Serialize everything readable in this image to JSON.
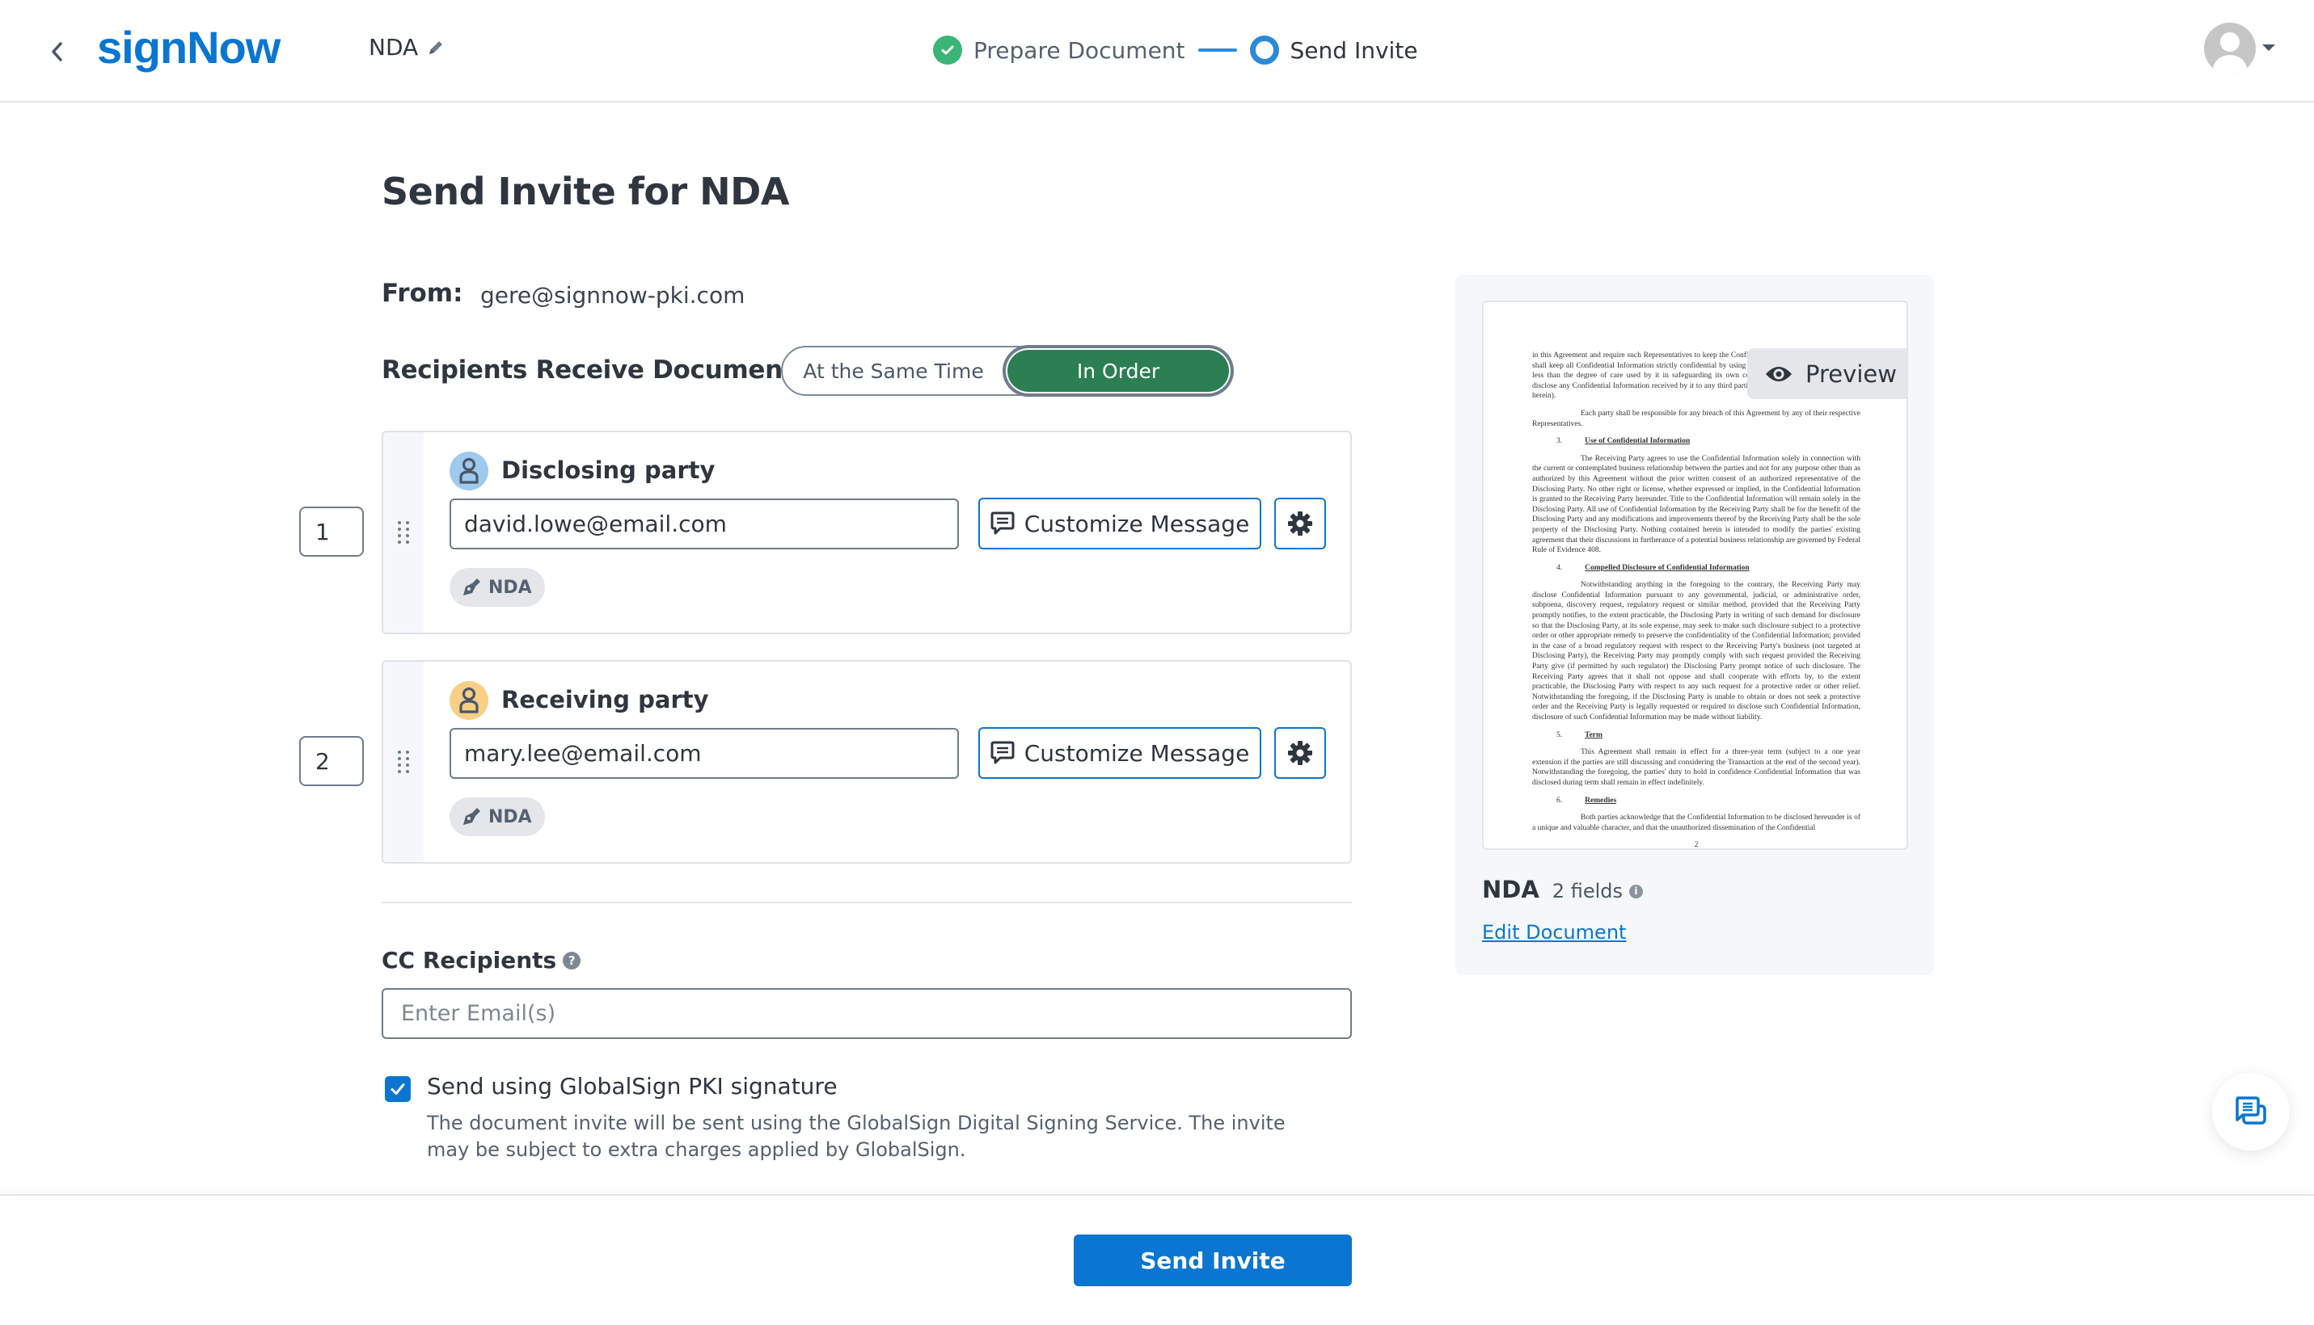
{
  "header": {
    "logo": "signNow",
    "document_name": "NDA",
    "steps": [
      {
        "label": "Prepare Document",
        "state": "done"
      },
      {
        "label": "Send Invite",
        "state": "current"
      }
    ],
    "colors": {
      "brand": "#0a76d1",
      "step_done": "#3bb575",
      "step_current": "#2c8ad8"
    }
  },
  "main": {
    "title": "Send Invite for NDA",
    "from_label": "From:",
    "from_value": "gere@signnow-pki.com",
    "order_label": "Recipients Receive Documents",
    "order_options": [
      {
        "label": "At the Same Time",
        "selected": false
      },
      {
        "label": "In Order",
        "selected": true
      }
    ],
    "recipients": [
      {
        "order": "1",
        "role": "Disclosing party",
        "avatar_color": "#9dcaee",
        "email": "david.lowe@email.com",
        "customize_label": "Customize Message",
        "document_badge": "NDA"
      },
      {
        "order": "2",
        "role": "Receiving party",
        "avatar_color": "#f7cf85",
        "email": "mary.lee@email.com",
        "customize_label": "Customize Message",
        "document_badge": "NDA"
      }
    ],
    "cc": {
      "label": "CC Recipients",
      "help_icon": "?",
      "placeholder": "Enter Email(s)",
      "value": ""
    },
    "pki": {
      "checked": true,
      "label": "Send using GlobalSign PKI signature",
      "description": "The document invite will be sent using the GlobalSign Digital Signing Service. The invite may be subject to extra charges applied by GlobalSign."
    }
  },
  "preview_panel": {
    "preview_label": "Preview",
    "doc_name": "NDA",
    "fields_count": "2 fields",
    "edit_link": "Edit Document",
    "page_text": {
      "p1": "in this Agreement and require such Representatives to keep the Confidential Information confidential, (b) shall keep all Confidential Information strictly confidential by using a reasonable degree of care, but not less than the degree of care used by it in safeguarding its own confidential information, and (c) not disclose any Confidential Information received by it to any third parties (except as otherwise provided for herein).",
      "p2": "Each party shall be responsible for any breach of this Agreement by any of their respective Representatives.",
      "h3_num": "3.",
      "h3": "Use of Confidential Information",
      "p3": "The Receiving Party agrees to use the Confidential Information solely in connection with the current or contemplated business relationship between the parties and not for any purpose other than as authorized by this Agreement without the prior written consent of an authorized representative of the Disclosing Party. No other right or license, whether expressed or implied, in the Confidential Information is granted to the Receiving Party hereunder. Title to the Confidential Information will remain solely in the Disclosing Party. All use of Confidential Information by the Receiving Party shall be for the benefit of the Disclosing Party and any modifications and improvements thereof by the Receiving Party shall be the sole property of the Disclosing Party. Nothing contained herein is intended to modify the parties' existing agreement that their discussions in furtherance of a potential business relationship are governed by Federal Rule of Evidence 408.",
      "h4_num": "4.",
      "h4": "Compelled Disclosure of Confidential Information",
      "p4": "Notwithstanding anything in the foregoing to the contrary, the Receiving Party may disclose Confidential Information pursuant to any governmental, judicial, or administrative order, subpoena, discovery request, regulatory request or similar method, provided that the Receiving Party promptly notifies, to the extent practicable, the Disclosing Party in writing of such demand for disclosure so that the Disclosing Party, at its sole expense, may seek to make such disclosure subject to a protective order or other appropriate remedy to preserve the confidentiality of the Confidential Information; provided in the case of a broad regulatory request with respect to the Receiving Party's business (not targeted at Disclosing Party), the Receiving Party may promptly comply with such request provided the Receiving Party give (if permitted by such regulator) the Disclosing Party prompt notice of such disclosure. The Receiving Party agrees that it shall not oppose and shall cooperate with efforts by, to the extent practicable, the Disclosing Party with respect to any such request for a protective order or other relief. Notwithstanding the foregoing, if the Disclosing Party is unable to obtain or does not seek a protective order and the Receiving Party is legally requested or required to disclose such Confidential Information, disclosure of such Confidential Information may be made without liability.",
      "h5_num": "5.",
      "h5": "Term",
      "p5": "This Agreement shall remain in effect for a three-year term (subject to a one year extension if the parties are still discussing and considering the Transaction at the end of the second year). Notwithstanding the foregoing, the parties' duty to hold in confidence Confidential Information that was disclosed during term shall remain in effect indefinitely.",
      "h6_num": "6.",
      "h6": "Remedies",
      "p6": "Both parties acknowledge that the Confidential Information to be disclosed hereunder is of a unique and valuable character, and that the unauthorized dissemination of the Confidential",
      "page_number": "2"
    }
  },
  "footer": {
    "send_label": "Send Invite"
  }
}
